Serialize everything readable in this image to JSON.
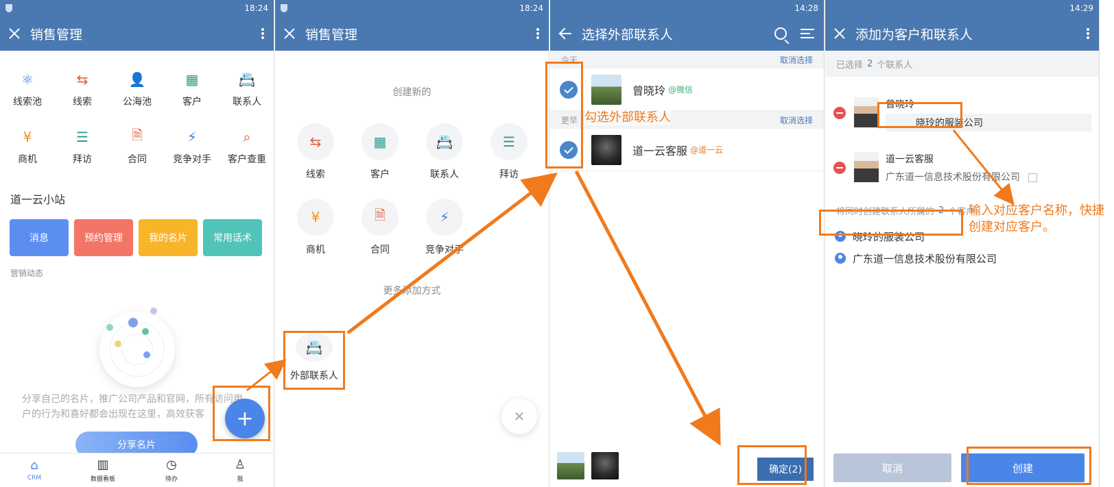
{
  "panel1": {
    "time": "18:24",
    "title": "销售管理",
    "grid": [
      {
        "label": "线索池",
        "icon": "nodes-icon",
        "color": "#4a78d8"
      },
      {
        "label": "线索",
        "icon": "route-icon",
        "color": "#e35d3a"
      },
      {
        "label": "公海池",
        "icon": "user-list-icon",
        "color": "#4a78d8"
      },
      {
        "label": "客户",
        "icon": "building-icon",
        "color": "#2a9d8f"
      },
      {
        "label": "联系人",
        "icon": "contact-card-icon",
        "color": "#e8952a"
      },
      {
        "label": "商机",
        "icon": "yen-coin-icon",
        "color": "#e8952a"
      },
      {
        "label": "拜访",
        "icon": "chat-note-icon",
        "color": "#2a9d8f"
      },
      {
        "label": "合同",
        "icon": "document-icon",
        "color": "#e35d3a"
      },
      {
        "label": "竞争对手",
        "icon": "users-bolt-icon",
        "color": "#4a78d8"
      },
      {
        "label": "客户查重",
        "icon": "user-search-icon",
        "color": "#e35d3a"
      }
    ],
    "section_title": "道一云小站",
    "tiles": [
      {
        "label": "消息",
        "color": "#5b8ef0"
      },
      {
        "label": "预约管理",
        "color": "#f37566"
      },
      {
        "label": "我的名片",
        "color": "#f8b52a"
      },
      {
        "label": "常用话术",
        "color": "#52c3b8"
      }
    ],
    "sub_title": "营销动态",
    "description": "分享自己的名片，推广公司产品和官网，所有访问用户的行为和喜好都会出现在这里，高效获客",
    "share_button": "分享名片",
    "fab": "+",
    "nav": [
      {
        "label": "CRM",
        "icon": "home-icon"
      },
      {
        "label": "数据看板",
        "icon": "chart-icon"
      },
      {
        "label": "待办",
        "icon": "clock-icon"
      },
      {
        "label": "我",
        "icon": "person-icon"
      }
    ]
  },
  "panel2": {
    "time": "18:24",
    "title": "销售管理",
    "caption": "创建新的",
    "items": [
      {
        "label": "线索",
        "icon": "route-icon",
        "color": "#e35d3a"
      },
      {
        "label": "客户",
        "icon": "building-icon",
        "color": "#2a9d8f"
      },
      {
        "label": "联系人",
        "icon": "contact-card-icon",
        "color": "#e8952a"
      },
      {
        "label": "拜访",
        "icon": "chat-note-icon",
        "color": "#2a9d8f"
      },
      {
        "label": "商机",
        "icon": "yen-coin-icon",
        "color": "#e8952a"
      },
      {
        "label": "合同",
        "icon": "document-icon",
        "color": "#e35d3a"
      },
      {
        "label": "竞争对手",
        "icon": "users-bolt-icon",
        "color": "#4a78d8"
      }
    ],
    "more_caption": "更多添加方式",
    "external": "外部联系人"
  },
  "panel3": {
    "time": "14:28",
    "title": "选择外部联系人",
    "groups": [
      {
        "header": "今天",
        "cancel": "取消选择",
        "name": "曾晓玲",
        "tag": "@微信",
        "tag_color": "#3cb371"
      },
      {
        "header": "更早",
        "cancel": "取消选择",
        "name": "道一云客服",
        "tag": "@道一云",
        "tag_color": "#f07a1c"
      }
    ],
    "annotation": "勾选外部联系人",
    "confirm": "确定(2)"
  },
  "panel4": {
    "time": "14:29",
    "title": "添加为客户和联系人",
    "selected_prefix": "已选择",
    "selected_count": "2",
    "selected_suffix": "个联系人",
    "people": [
      {
        "name": "曾晓玲",
        "company": "晓玲的服装公司"
      },
      {
        "name": "道一云客服",
        "company": "广东道一信息技术股份有限公司"
      }
    ],
    "customers_prefix": "将同时创建联系人所属的",
    "customers_count": "2",
    "customers_suffix": "个客户",
    "customers": [
      "晓玲的服装公司",
      "广东道一信息技术股份有限公司"
    ],
    "annotation": "输入对应客户名称，快捷创建对应客户。",
    "cancel": "取消",
    "create": "创建"
  },
  "colors": {
    "appbar": "#4a78b0",
    "accent": "#f07a1c",
    "primary": "#4a86e8"
  }
}
